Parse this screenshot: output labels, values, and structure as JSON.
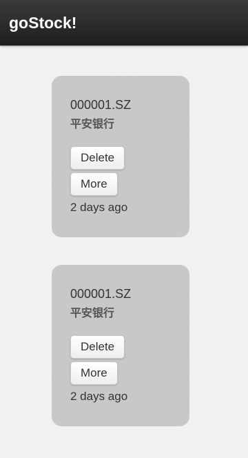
{
  "header": {
    "title": "goStock!"
  },
  "cards": [
    {
      "ticker": "000001.SZ",
      "name": "平安银行",
      "delete_label": "Delete",
      "more_label": "More",
      "timestamp": "2 days ago"
    },
    {
      "ticker": "000001.SZ",
      "name": "平安银行",
      "delete_label": "Delete",
      "more_label": "More",
      "timestamp": "2 days ago"
    }
  ],
  "colors": {
    "header_bg": "#2a2a2a",
    "card_bg": "#c8c8c8",
    "page_bg": "#f3f3f3"
  }
}
